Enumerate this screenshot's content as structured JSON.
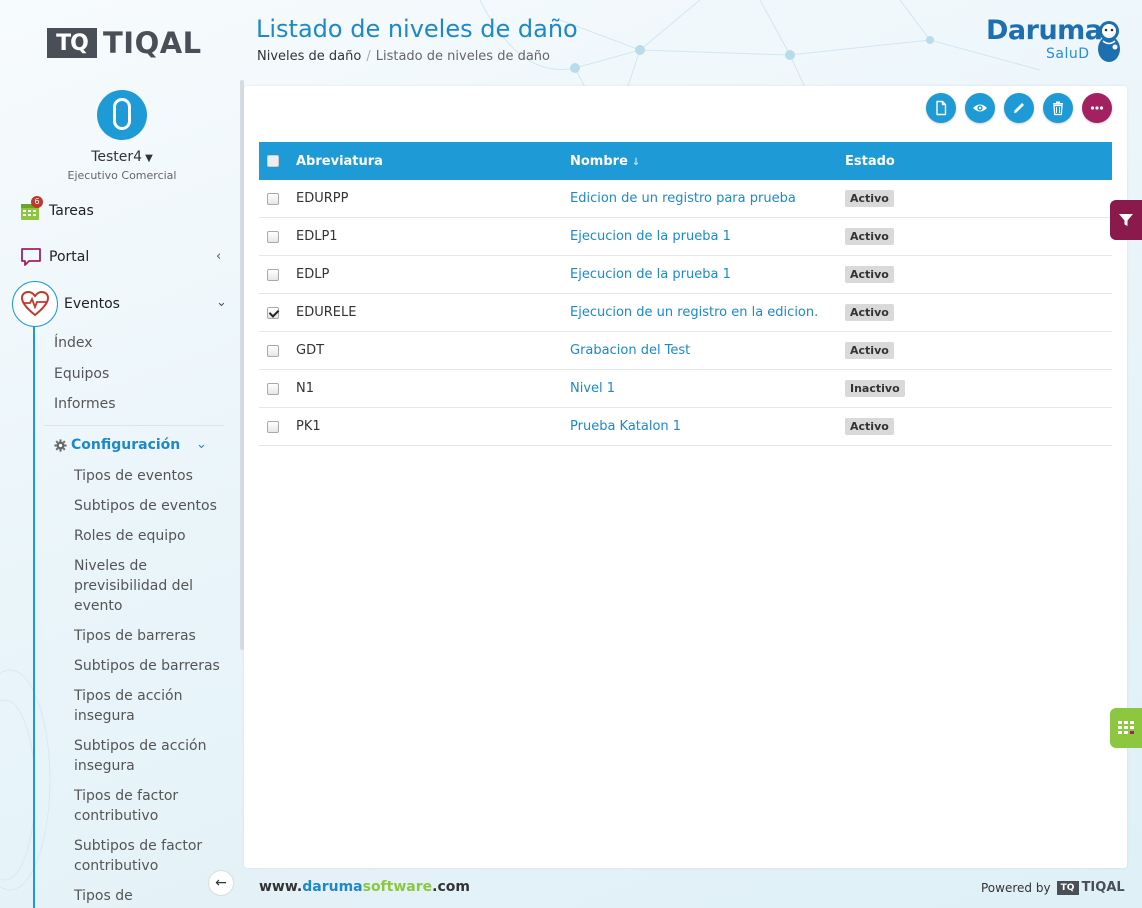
{
  "sidebar": {
    "logo_mark": "TQ",
    "logo_text": "TIQAL",
    "user": {
      "name": "Tester4",
      "role": "Ejecutivo Comercial"
    },
    "nav": {
      "tareas": {
        "label": "Tareas",
        "badge": "6"
      },
      "portal": {
        "label": "Portal"
      },
      "eventos": {
        "label": "Eventos"
      }
    },
    "eventos_items": [
      "Índex",
      "Equipos",
      "Informes"
    ],
    "configuracion": {
      "label": "Configuración",
      "items": [
        "Tipos de eventos",
        "Subtipos de eventos",
        "Roles de equipo",
        "Niveles de previsibilidad del evento",
        "Tipos de barreras",
        "Subtipos de barreras",
        "Tipos de acción insegura",
        "Subtipos de acción insegura",
        "Tipos de factor contributivo",
        "Subtipos de factor contributivo",
        "Tipos de organización"
      ]
    }
  },
  "header": {
    "title": "Listado de niveles de daño",
    "breadcrumb": {
      "parent": "Niveles de daño",
      "separator": "/",
      "current": "Listado de niveles de daño"
    },
    "brand_name": "Daruma",
    "brand_sub": "SaluD"
  },
  "table": {
    "columns": {
      "abbr": "Abreviatura",
      "name": "Nombre",
      "status": "Estado"
    },
    "rows": [
      {
        "abbr": "EDURPP",
        "name": "Edicion de un registro para prueba",
        "status": "Activo",
        "checked": false
      },
      {
        "abbr": "EDLP1",
        "name": "Ejecucion de la prueba 1",
        "status": "Activo",
        "checked": false
      },
      {
        "abbr": "EDLP",
        "name": "Ejecucion de la prueba 1",
        "status": "Activo",
        "checked": false
      },
      {
        "abbr": "EDURELE",
        "name": "Ejecucion de un registro en la edicion.",
        "status": "Activo",
        "checked": true
      },
      {
        "abbr": "GDT",
        "name": "Grabacion del Test",
        "status": "Activo",
        "checked": false
      },
      {
        "abbr": "N1",
        "name": "Nivel 1",
        "status": "Inactivo",
        "checked": false
      },
      {
        "abbr": "PK1",
        "name": "Prueba Katalon 1",
        "status": "Activo",
        "checked": false
      }
    ]
  },
  "actions": [
    "new-icon",
    "view-icon",
    "edit-icon",
    "delete-icon",
    "more-icon"
  ],
  "footer": {
    "prefix": "www.",
    "daruma": "daruma",
    "software": "software",
    "suffix": ".com",
    "powered_by": "Powered by",
    "powered_mark": "TQ",
    "powered_text": "TIQAL"
  },
  "colors": {
    "accent": "#1e9ad6",
    "more_button": "#a32161",
    "filter_tab": "#8b1a4c",
    "grid_tab": "#8dc63f"
  }
}
